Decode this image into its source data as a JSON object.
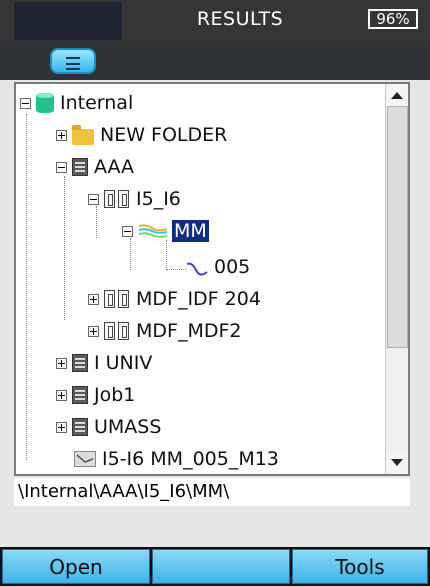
{
  "window": {
    "title": "RESULTS",
    "battery": "96%"
  },
  "toolbar": {
    "menu_icon": "menu-icon"
  },
  "tree": {
    "root": {
      "label": "Internal",
      "icon": "database-icon"
    },
    "items": [
      {
        "label": "NEW FOLDER",
        "icon": "folder-icon"
      },
      {
        "label": "AAA",
        "icon": "job-icon"
      },
      {
        "label": "I5_I6",
        "icon": "fiber-pair-icon"
      },
      {
        "label": "MM",
        "icon": "measurement-icon"
      },
      {
        "label": "005",
        "icon": "trace-icon"
      },
      {
        "label": "MDF_IDF 204",
        "icon": "fiber-pair-icon"
      },
      {
        "label": "MDF_MDF2",
        "icon": "fiber-pair-icon"
      },
      {
        "label": "I UNIV",
        "icon": "job-icon"
      },
      {
        "label": "Job1",
        "icon": "job-icon"
      },
      {
        "label": "UMASS",
        "icon": "job-icon"
      },
      {
        "label": "I5-I6 MM_005_M13",
        "icon": "result-file-icon"
      }
    ]
  },
  "path": "\\Internal\\AAA\\I5_I6\\MM\\",
  "softkeys": {
    "left": "Open",
    "middle": "",
    "right": "Tools"
  },
  "colors": {
    "selection": "#0f2c80",
    "softkey": "#3db3e6",
    "titlebar": "#353535"
  }
}
